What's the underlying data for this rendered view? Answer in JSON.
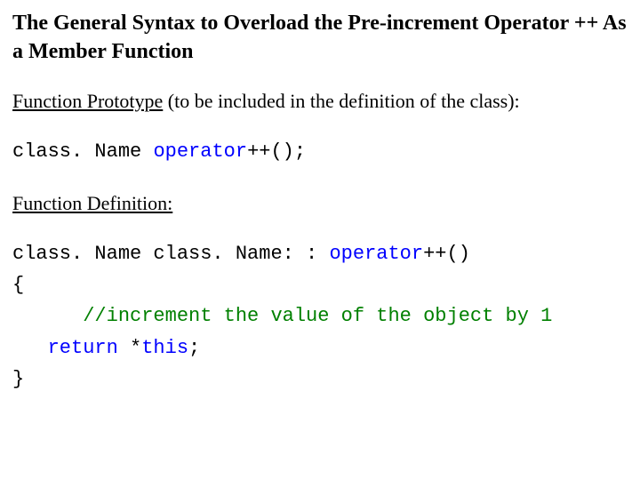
{
  "title": "The General Syntax to Overload the Pre-increment Operator ++ As a Member Function",
  "proto": {
    "label_underlined": "Function Prototype",
    "label_rest": " (to be included in the definition of the class):",
    "code_pre": "class. Name ",
    "code_kw": "operator",
    "code_post": "++();"
  },
  "def": {
    "label": "Function Definition:",
    "l1_pre": "class. Name class. Name: : ",
    "l1_kw": "operator",
    "l1_post": "++()",
    "l2": "{",
    "l3_indent": "      ",
    "l3_comment": "//increment the value of the object by 1",
    "l4_indent": "   ",
    "l4_kw": "return",
    "l4_rest": " *",
    "l4_kw2": "this",
    "l4_end": ";",
    "l5": "}"
  }
}
